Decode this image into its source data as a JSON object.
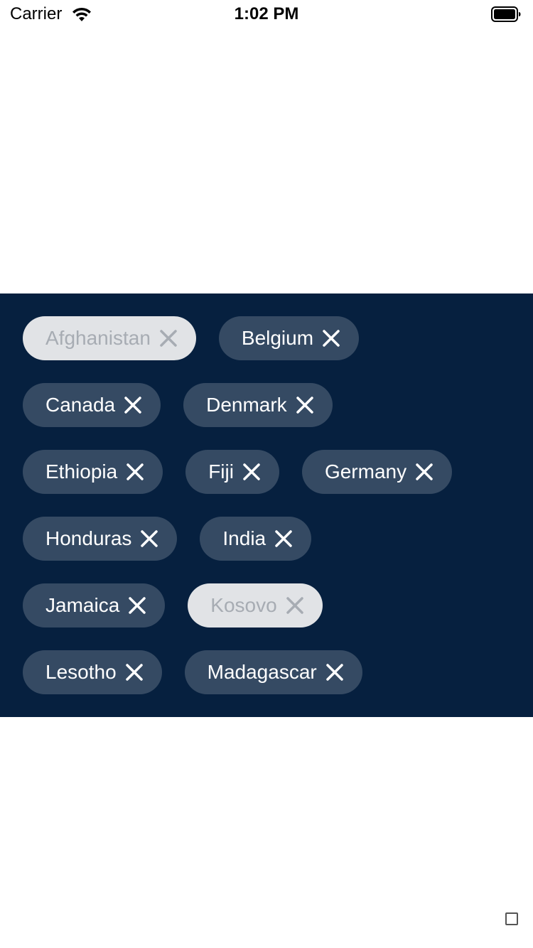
{
  "status_bar": {
    "carrier": "Carrier",
    "time": "1:02 PM"
  },
  "chips": [
    {
      "label": "Afghanistan",
      "disabled": true
    },
    {
      "label": "Belgium",
      "disabled": false
    },
    {
      "label": "Canada",
      "disabled": false
    },
    {
      "label": "Denmark",
      "disabled": false
    },
    {
      "label": "Ethiopia",
      "disabled": false
    },
    {
      "label": "Fiji",
      "disabled": false
    },
    {
      "label": "Germany",
      "disabled": false
    },
    {
      "label": "Honduras",
      "disabled": false
    },
    {
      "label": "India",
      "disabled": false
    },
    {
      "label": "Jamaica",
      "disabled": false
    },
    {
      "label": "Kosovo",
      "disabled": true
    },
    {
      "label": "Lesotho",
      "disabled": false
    },
    {
      "label": "Madagascar",
      "disabled": false
    }
  ],
  "colors": {
    "panel_background": "#06203f",
    "chip_background": "#354a63",
    "chip_text": "#ffffff",
    "chip_disabled_background": "#e1e3e6",
    "chip_disabled_text": "#a7acb3"
  },
  "icons": {
    "chip_remove": "close-icon",
    "wifi": "wifi-icon",
    "battery": "battery-icon"
  }
}
